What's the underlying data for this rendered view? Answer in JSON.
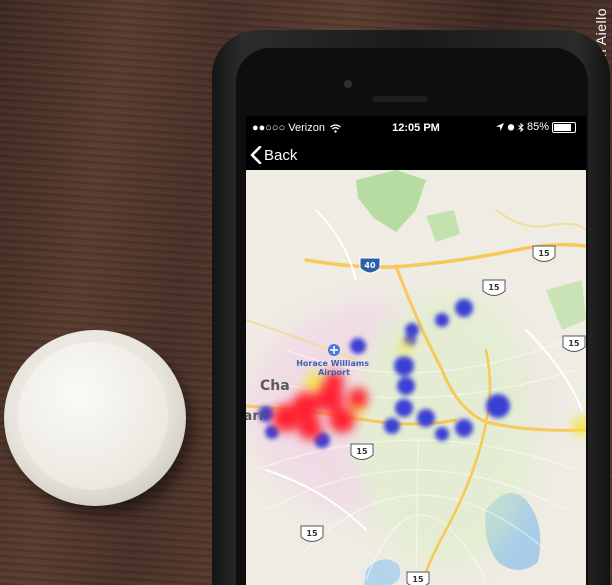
{
  "photo": {
    "credit": "Photo by Allison Aiello"
  },
  "status_bar": {
    "carrier": "●●○○○ Verizon",
    "time": "12:05 PM",
    "battery": "85%",
    "battery_level": 0.85,
    "location_icon": "location-arrow-icon",
    "bluetooth_icon": "bluetooth-icon",
    "wifi_icon": "wifi-icon"
  },
  "nav": {
    "back_label": "Back",
    "back_icon": "chevron-left-icon"
  },
  "map": {
    "airport_label": "Horace Williams Airport",
    "town_label_1": "Cha",
    "town_label_2": "Carr",
    "shields": [
      {
        "route": "40",
        "type": "interstate"
      },
      {
        "route": "15",
        "type": "us"
      },
      {
        "route": "15",
        "type": "us"
      },
      {
        "route": "15",
        "type": "us"
      },
      {
        "route": "15",
        "type": "us"
      },
      {
        "route": "15",
        "type": "us"
      },
      {
        "route": "15",
        "type": "us"
      }
    ],
    "colors": {
      "land": "#efece3",
      "park": "#b7dca2",
      "water": "#a9cde8",
      "road_major": "#f7c85a",
      "heat_high": "#ff2030",
      "heat_mid": "#f3e44a",
      "heat_low": "#3a3fd4"
    }
  }
}
